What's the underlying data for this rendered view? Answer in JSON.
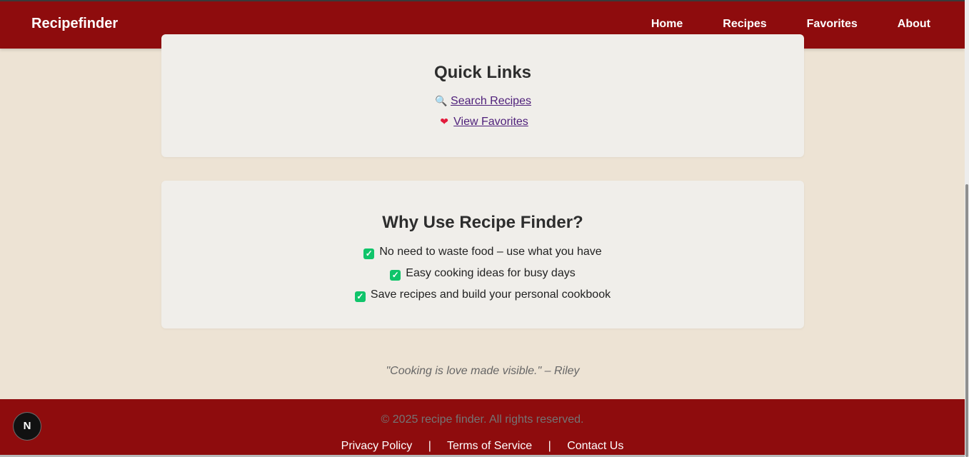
{
  "brand": "Recipefinder",
  "nav": {
    "home": "Home",
    "recipes": "Recipes",
    "favorites": "Favorites",
    "about": "About"
  },
  "quick_links": {
    "title": "Quick Links",
    "items": [
      {
        "icon": "search-icon",
        "glyph": "🔍",
        "label": "Search Recipes"
      },
      {
        "icon": "heart-icon",
        "glyph": "❤",
        "label": "View Favorites"
      }
    ]
  },
  "why": {
    "title": "Why Use Recipe Finder?",
    "items": [
      {
        "label": "No need to waste food – use what you have"
      },
      {
        "label": "Easy cooking ideas for busy days"
      },
      {
        "label": "Save recipes and build your personal cookbook"
      }
    ]
  },
  "quote": "\"Cooking is love made visible.\" – Riley",
  "footer": {
    "copyright": "© 2025 recipe finder. All rights reserved.",
    "privacy": "Privacy Policy",
    "terms": "Terms of Service",
    "contact": "Contact Us",
    "separator": "|"
  },
  "floating_badge": "N",
  "colors": {
    "primary": "#8e0c0d",
    "page_background": "#ede3d4",
    "card_background": "#f0eeea",
    "link": "#4e1f7a",
    "check": "#10c46a"
  }
}
